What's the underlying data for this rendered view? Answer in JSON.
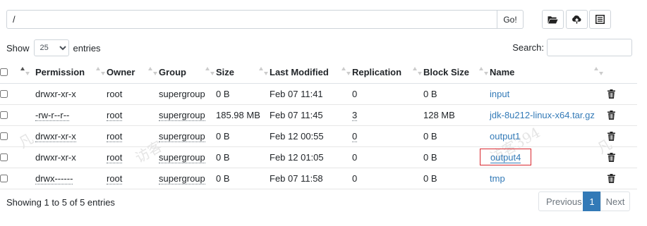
{
  "path": {
    "value": "/",
    "go_label": "Go!"
  },
  "toolbar": {
    "icons": [
      "folder-open-icon",
      "cloud-upload-icon",
      "list-icon"
    ]
  },
  "length": {
    "show_label": "Show",
    "selected": "25",
    "entries_label": "entries"
  },
  "search": {
    "label": "Search:",
    "value": ""
  },
  "table": {
    "headers": [
      "Permission",
      "Owner",
      "Group",
      "Size",
      "Last Modified",
      "Replication",
      "Block Size",
      "Name"
    ],
    "rows": [
      {
        "permission": "drwxr-xr-x",
        "owner": "root",
        "group": "supergroup",
        "size": "0 B",
        "modified": "Feb 07 11:41",
        "replication": "0",
        "block_size": "0 B",
        "name": "input"
      },
      {
        "permission": "-rw-r--r--",
        "owner": "root",
        "group": "supergroup",
        "size": "185.98 MB",
        "modified": "Feb 07 11:45",
        "replication": "3",
        "block_size": "128 MB",
        "name": "jdk-8u212-linux-x64.tar.gz"
      },
      {
        "permission": "drwxr-xr-x",
        "owner": "root",
        "group": "supergroup",
        "size": "0 B",
        "modified": "Feb 12 00:55",
        "replication": "0",
        "block_size": "0 B",
        "name": "output1"
      },
      {
        "permission": "drwxr-xr-x",
        "owner": "root",
        "group": "supergroup",
        "size": "0 B",
        "modified": "Feb 12 01:05",
        "replication": "0",
        "block_size": "0 B",
        "name": "output4"
      },
      {
        "permission": "drwx------",
        "owner": "root",
        "group": "supergroup",
        "size": "0 B",
        "modified": "Feb 07 11:58",
        "replication": "0",
        "block_size": "0 B",
        "name": "tmp"
      }
    ]
  },
  "info": "Showing 1 to 5 of 5 entries",
  "pager": {
    "previous": "Previous",
    "page": "1",
    "next": "Next"
  },
  "colors": {
    "link": "#337ab7",
    "highlight_box": "#d9282f",
    "active_page": "#337ab7"
  },
  "watermarks": [
    "凡",
    "访客",
    "访客394",
    "凡"
  ]
}
